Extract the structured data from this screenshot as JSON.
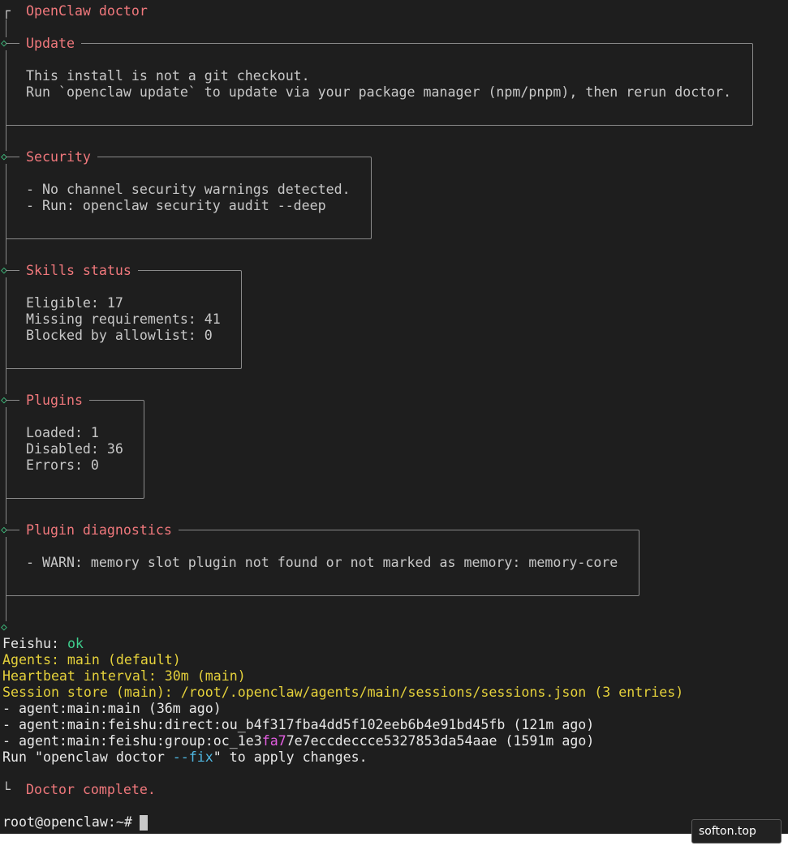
{
  "header": {
    "corner_glyph": "┌",
    "title": "OpenClaw doctor"
  },
  "sections": [
    {
      "title": "Update",
      "lines": [
        "This install is not a git checkout.",
        "Run `openclaw update` to update via your package manager (npm/pnpm), then rerun doctor."
      ]
    },
    {
      "title": "Security",
      "lines": [
        "- No channel security warnings detected.",
        "- Run: openclaw security audit --deep"
      ]
    },
    {
      "title": "Skills status",
      "lines": [
        "Eligible: 17",
        "Missing requirements: 41",
        "Blocked by allowlist: 0"
      ]
    },
    {
      "title": "Plugins",
      "lines": [
        "Loaded: 1",
        "Disabled: 36",
        "Errors: 0"
      ]
    },
    {
      "title": "Plugin diagnostics",
      "lines": [
        "- WARN: memory slot plugin not found or not marked as memory: memory-core"
      ]
    }
  ],
  "status": {
    "diamond": "◇",
    "feishu_label": "Feishu: ",
    "feishu_value": "ok",
    "agents": "Agents: main (default)",
    "heartbeat": "Heartbeat interval: 30m (main)",
    "session_store": "Session store (main): /root/.openclaw/agents/main/sessions/sessions.json (3 entries)",
    "sessions": [
      "- agent:main:main (36m ago)",
      "- agent:main:feishu:direct:ou_b4f317fba4dd5f102eeb6b4e91bd45fb (121m ago)"
    ],
    "group_session": {
      "prefix": "- agent:main:feishu:group:oc_1e3",
      "highlight": "fa7",
      "suffix": "7e7eccdeccce5327853da54aae (1591m ago)"
    },
    "fix_hint": {
      "prefix": "Run \"openclaw doctor ",
      "flag": "--fix",
      "suffix": "\" to apply changes."
    }
  },
  "footer": {
    "corner_glyph": "└",
    "message": "Doctor complete."
  },
  "prompt": "root@openclaw:~# ",
  "watermark": "softon.top",
  "colors": {
    "background": "#1e1e1e",
    "heading": "#f0787c",
    "diamond": "#3fbf7f",
    "ok": "#3fcf8e",
    "status_yellow": "#e5d13b",
    "flag_cyan": "#4fb6e0",
    "highlight_magenta": "#e25de0",
    "border": "#8a8a8a"
  }
}
